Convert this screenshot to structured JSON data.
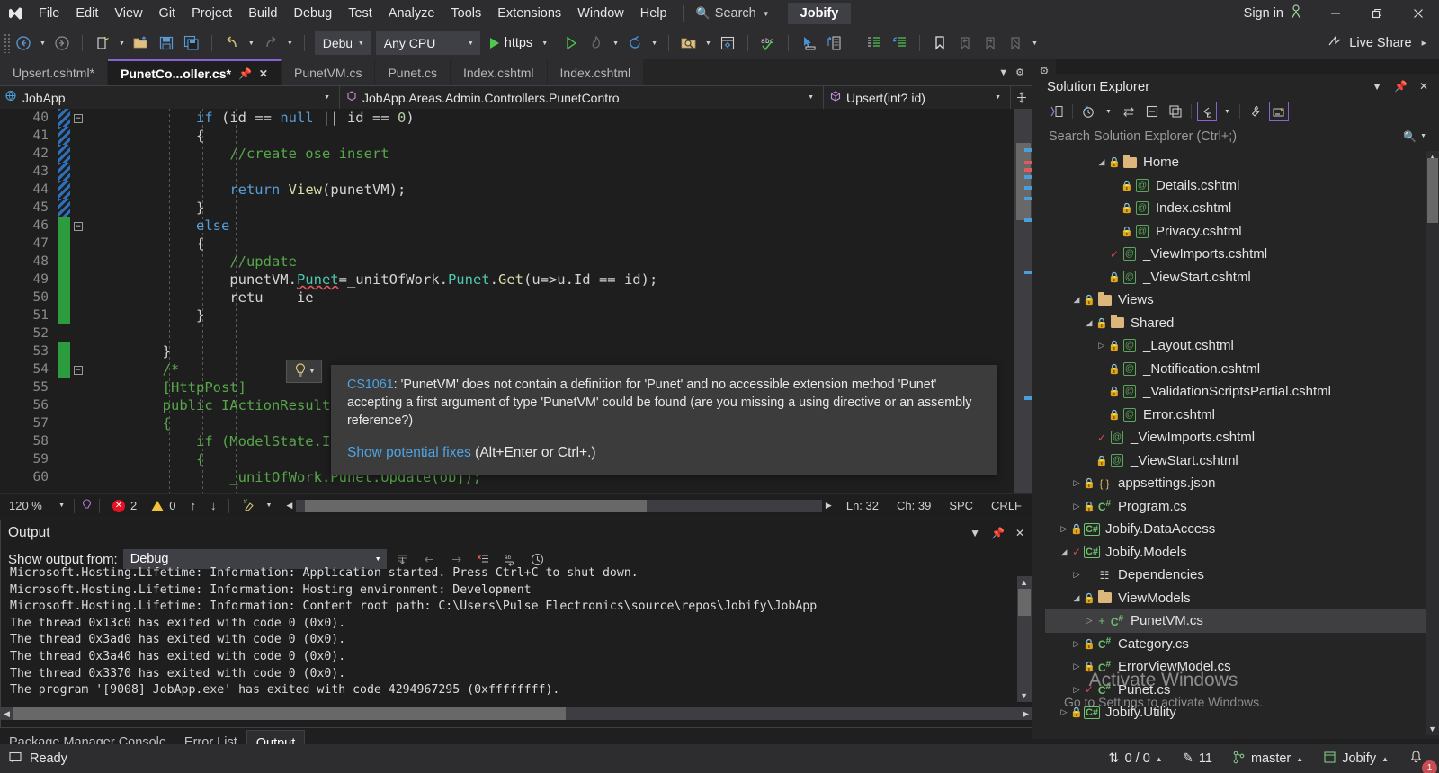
{
  "titlebar": {
    "logo_icon": "visual-studio-logo",
    "menus": [
      "File",
      "Edit",
      "View",
      "Git",
      "Project",
      "Build",
      "Debug",
      "Test",
      "Analyze",
      "Tools",
      "Extensions",
      "Window",
      "Help"
    ],
    "search_placeholder": "Search",
    "search_icon": "magnifier-icon",
    "solution_chip": "Jobify",
    "sign_in": "Sign in",
    "sign_in_icon": "user-icon",
    "minimize_icon": "minimize-icon",
    "restore_icon": "restore-icon",
    "close_icon": "close-icon"
  },
  "toolbar": {
    "back_icon": "navigate-back-icon",
    "forward_icon": "navigate-forward-icon",
    "new_item_icon": "new-item-icon",
    "open_icon": "open-file-icon",
    "save_icon": "save-icon",
    "save_all_icon": "save-all-icon",
    "undo_icon": "undo-icon",
    "redo_icon": "redo-icon",
    "config": "Debug",
    "platform": "Any CPU",
    "run_label": "https",
    "run_icon": "start-debug-icon",
    "run_no_debug_icon": "start-without-debug-icon",
    "hot_reload_icon": "hot-reload-icon",
    "restart_icon": "restart-icon",
    "find_in_files_icon": "find-in-files-icon",
    "solution_icon": "solution-icon",
    "spellcheck_icon": "abc-spellcheck-icon",
    "pointer_icon": "select-element-icon",
    "nav_icon": "go-to-icon",
    "comment_icon": "comment-lines-icon",
    "uncomment_icon": "uncomment-lines-icon",
    "bookmark_icon": "bookmark-icon",
    "prev_bookmark_icon": "previous-bookmark-icon",
    "next_bookmark_icon": "next-bookmark-icon",
    "clear_bookmark_icon": "clear-bookmarks-icon",
    "live_share": "Live Share",
    "live_share_icon": "live-share-icon",
    "overflow_icon": "toolbar-overflow-icon"
  },
  "editor": {
    "tabs": [
      {
        "label": "Upsert.cshtml*",
        "active": false
      },
      {
        "label": "PunetCo...oller.cs*",
        "active": true
      },
      {
        "label": "PunetVM.cs",
        "active": false
      },
      {
        "label": "Punet.cs",
        "active": false
      },
      {
        "label": "Index.cshtml",
        "active": false
      },
      {
        "label": "Index.cshtml",
        "active": false
      }
    ],
    "tab_pin_icon": "pin-icon",
    "tab_close_icon": "close-icon",
    "tab_overflow_icon": "tab-overflow-icon",
    "navbar": {
      "project": "JobApp",
      "project_icon": "web-project-icon",
      "type": "JobApp.Areas.Admin.Controllers.PunetContro",
      "type_icon": "class-icon",
      "member": "Upsert(int? id)",
      "member_icon": "method-icon",
      "split_icon": "split-view-icon"
    },
    "lines": [
      {
        "n": 40,
        "marker": "blue",
        "fold": "minus",
        "indent": 12,
        "html": "if (id == null || id == 0)"
      },
      {
        "n": 41,
        "marker": "blue",
        "fold": "",
        "indent": 12,
        "html": "{"
      },
      {
        "n": 42,
        "marker": "blue",
        "fold": "",
        "indent": 16,
        "html": "//create ose insert"
      },
      {
        "n": 43,
        "marker": "blue",
        "fold": "",
        "indent": 16,
        "html": ""
      },
      {
        "n": 44,
        "marker": "blue",
        "fold": "",
        "indent": 16,
        "html": "return View(punetVM);"
      },
      {
        "n": 45,
        "marker": "blue",
        "fold": "",
        "indent": 12,
        "html": "}"
      },
      {
        "n": 46,
        "marker": "green",
        "fold": "minus",
        "indent": 12,
        "html": "else"
      },
      {
        "n": 47,
        "marker": "green",
        "fold": "",
        "indent": 12,
        "html": "{"
      },
      {
        "n": 48,
        "marker": "green",
        "fold": "",
        "indent": 16,
        "html": "//update"
      },
      {
        "n": 49,
        "marker": "green",
        "fold": "",
        "indent": 16,
        "html": "punetVM.Punet=_unitOfWork.Punet.Get(u=>u.Id == id);"
      },
      {
        "n": 50,
        "marker": "green",
        "fold": "",
        "indent": 16,
        "html": "retu    ie"
      },
      {
        "n": 51,
        "marker": "green",
        "fold": "",
        "indent": 12,
        "html": "}"
      },
      {
        "n": 52,
        "marker": "",
        "fold": "",
        "indent": 12,
        "html": ""
      },
      {
        "n": 53,
        "marker": "green",
        "fold": "",
        "indent": 8,
        "html": "}"
      },
      {
        "n": 54,
        "marker": "green",
        "fold": "minus",
        "indent": 8,
        "html": "/*"
      },
      {
        "n": 55,
        "marker": "",
        "fold": "",
        "indent": 8,
        "html": "[HttpPost]"
      },
      {
        "n": 56,
        "marker": "",
        "fold": "",
        "indent": 8,
        "html": "public IActionResult Edit(Punet obj)"
      },
      {
        "n": 57,
        "marker": "",
        "fold": "",
        "indent": 8,
        "html": "{"
      },
      {
        "n": 58,
        "marker": "",
        "fold": "",
        "indent": 12,
        "html": "if (ModelState.IsValid)"
      },
      {
        "n": 59,
        "marker": "",
        "fold": "",
        "indent": 12,
        "html": "{"
      },
      {
        "n": 60,
        "marker": "",
        "fold": "",
        "indent": 16,
        "html": "_unitOfWork.Punet.Update(obj);"
      }
    ],
    "tooltip": {
      "code": "CS1061",
      "message": ": 'PunetVM' does not contain a definition for 'Punet' and no accessible extension method 'Punet' accepting a first argument of type 'PunetVM' could be found (are you missing a using directive or an assembly reference?)",
      "fix_link": "Show potential fixes",
      "fix_shortcut": "(Alt+Enter or Ctrl+.)",
      "lightbulb_icon": "lightbulb-icon"
    },
    "statusline": {
      "zoom": "120 %",
      "selection_icon": "selection-icon",
      "errors": "2",
      "warnings": "0",
      "up_icon": "previous-issue-icon",
      "down_icon": "next-issue-icon",
      "broom_icon": "code-cleanup-icon",
      "line": "Ln: 32",
      "col": "Ch: 39",
      "spaces": "SPC",
      "eol": "CRLF"
    }
  },
  "output": {
    "title": "Output",
    "title_caret_icon": "chevron-down-icon",
    "pin_icon": "pin-icon",
    "close_icon": "close-icon",
    "source_label": "Show output from:",
    "source_value": "Debug",
    "icons": [
      "find-message-icon",
      "go-to-previous-icon",
      "go-to-next-icon",
      "clear-all-icon",
      "word-wrap-icon",
      "toggle-timestamp-icon"
    ],
    "lines": [
      "Microsoft.Hosting.Lifetime: Information: Application started. Press Ctrl+C to shut down.",
      "Microsoft.Hosting.Lifetime: Information: Hosting environment: Development",
      "Microsoft.Hosting.Lifetime: Information: Content root path: C:\\Users\\Pulse Electronics\\source\\repos\\Jobify\\JobApp",
      "The thread 0x13c0 has exited with code 0 (0x0).",
      "The thread 0x3ad0 has exited with code 0 (0x0).",
      "The thread 0x3a40 has exited with code 0 (0x0).",
      "The thread 0x3370 has exited with code 0 (0x0).",
      "The program '[9008] JobApp.exe' has exited with code 4294967295 (0xffffffff)."
    ],
    "doc_tabs": [
      {
        "label": "Package Manager Console",
        "active": false
      },
      {
        "label": "Error List",
        "active": false
      },
      {
        "label": "Output",
        "active": true
      }
    ]
  },
  "solution_explorer": {
    "title": "Solution Explorer",
    "caret_icon": "chevron-down-icon",
    "pin_icon": "pin-icon",
    "close_icon": "close-icon",
    "toolbar_icons": [
      "code-view-icon",
      "pending-changes-icon",
      "sync-with-active-document-icon",
      "collapse-all-icon",
      "show-all-files-icon",
      "home-view-icon",
      "properties-icon",
      "preview-selected-items-icon"
    ],
    "search_placeholder": "Search Solution Explorer (Ctrl+;)",
    "search_icon": "magnifier-icon",
    "tree": [
      {
        "label": "Home",
        "indent": 4,
        "tw": "expanded",
        "glyph": "lock",
        "icon": "folder",
        "selected": false
      },
      {
        "label": "Details.cshtml",
        "indent": 5,
        "tw": "",
        "glyph": "lock",
        "icon": "razor",
        "selected": false
      },
      {
        "label": "Index.cshtml",
        "indent": 5,
        "tw": "",
        "glyph": "lock",
        "icon": "razor",
        "selected": false
      },
      {
        "label": "Privacy.cshtml",
        "indent": 5,
        "tw": "",
        "glyph": "lock",
        "icon": "razor",
        "selected": false
      },
      {
        "label": "_ViewImports.cshtml",
        "indent": 4,
        "tw": "",
        "glyph": "check",
        "icon": "razor",
        "selected": false
      },
      {
        "label": "_ViewStart.cshtml",
        "indent": 4,
        "tw": "",
        "glyph": "lock",
        "icon": "razor",
        "selected": false
      },
      {
        "label": "Views",
        "indent": 2,
        "tw": "expanded",
        "glyph": "lock",
        "icon": "folder",
        "selected": false
      },
      {
        "label": "Shared",
        "indent": 3,
        "tw": "expanded",
        "glyph": "lock",
        "icon": "folder",
        "selected": false
      },
      {
        "label": "_Layout.cshtml",
        "indent": 4,
        "tw": "collapsed",
        "glyph": "lock",
        "icon": "razor",
        "selected": false
      },
      {
        "label": "_Notification.cshtml",
        "indent": 4,
        "tw": "",
        "glyph": "lock",
        "icon": "razor",
        "selected": false
      },
      {
        "label": "_ValidationScriptsPartial.cshtml",
        "indent": 4,
        "tw": "",
        "glyph": "lock",
        "icon": "razor",
        "selected": false
      },
      {
        "label": "Error.cshtml",
        "indent": 4,
        "tw": "",
        "glyph": "lock",
        "icon": "razor",
        "selected": false
      },
      {
        "label": "_ViewImports.cshtml",
        "indent": 3,
        "tw": "",
        "glyph": "check",
        "icon": "razor",
        "selected": false
      },
      {
        "label": "_ViewStart.cshtml",
        "indent": 3,
        "tw": "",
        "glyph": "lock",
        "icon": "razor",
        "selected": false
      },
      {
        "label": "appsettings.json",
        "indent": 2,
        "tw": "collapsed",
        "glyph": "lock",
        "icon": "json",
        "selected": false
      },
      {
        "label": "Program.cs",
        "indent": 2,
        "tw": "collapsed",
        "glyph": "lock",
        "icon": "cs",
        "selected": false
      },
      {
        "label": "Jobify.DataAccess",
        "indent": 1,
        "tw": "collapsed",
        "glyph": "lock",
        "icon": "csproj",
        "selected": false
      },
      {
        "label": "Jobify.Models",
        "indent": 1,
        "tw": "expanded",
        "glyph": "check",
        "icon": "csproj",
        "selected": false
      },
      {
        "label": "Dependencies",
        "indent": 2,
        "tw": "collapsed",
        "glyph": "none",
        "icon": "deps",
        "selected": false
      },
      {
        "label": "ViewModels",
        "indent": 2,
        "tw": "expanded",
        "glyph": "lock",
        "icon": "folder",
        "selected": false
      },
      {
        "label": "PunetVM.cs",
        "indent": 3,
        "tw": "collapsed",
        "glyph": "plus",
        "icon": "cs",
        "selected": true
      },
      {
        "label": "Category.cs",
        "indent": 2,
        "tw": "collapsed",
        "glyph": "lock",
        "icon": "cs",
        "selected": false
      },
      {
        "label": "ErrorViewModel.cs",
        "indent": 2,
        "tw": "collapsed",
        "glyph": "lock",
        "icon": "cs",
        "selected": false
      },
      {
        "label": "Punet.cs",
        "indent": 2,
        "tw": "collapsed",
        "glyph": "check",
        "icon": "cs",
        "selected": false
      },
      {
        "label": "Jobify.Utility",
        "indent": 1,
        "tw": "collapsed",
        "glyph": "lock",
        "icon": "csproj",
        "selected": false
      }
    ]
  },
  "watermark": {
    "line1": "Activate Windows",
    "line2": "Go to Settings to activate Windows."
  },
  "statusbar": {
    "ready": "Ready",
    "ready_icon": "status-ready-icon",
    "sync_counts": "0 / 0",
    "sync_icon": "source-control-sync-icon",
    "pending_changes": "11",
    "pending_icon": "pencil-icon",
    "branch": "master",
    "branch_icon": "branch-icon",
    "repo": "Jobify",
    "repo_icon": "repository-icon",
    "notifications_icon": "bell-icon",
    "notifications_count": "1"
  }
}
